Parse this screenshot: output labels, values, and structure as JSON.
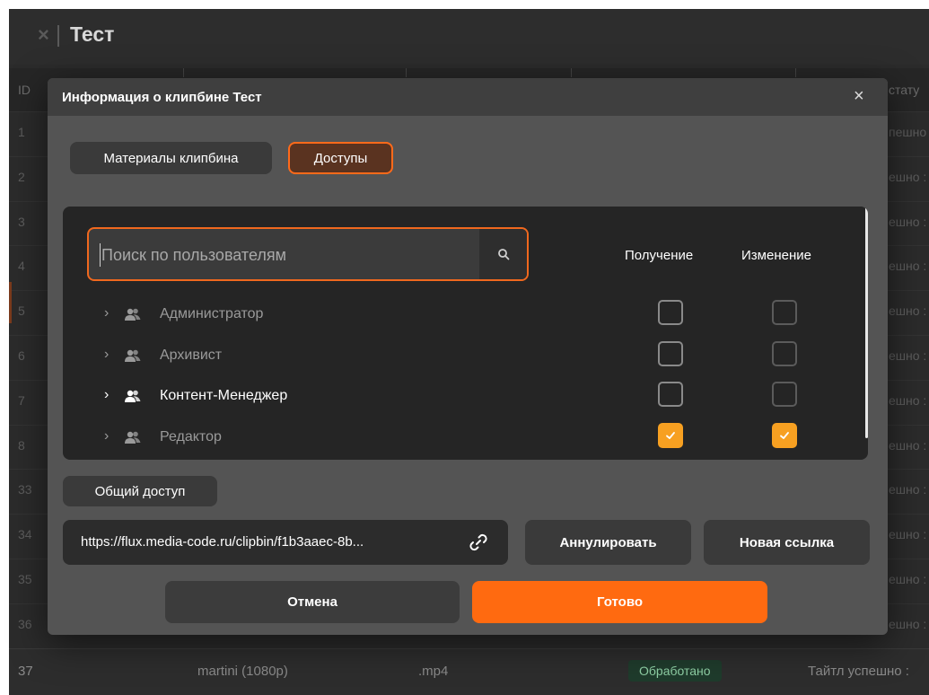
{
  "app": {
    "title": "Тест",
    "close_glyph": "×",
    "table": {
      "headers": {
        "id": "ID",
        "status": "стату"
      },
      "rows": [
        {
          "id": "1",
          "status": "пешно :"
        },
        {
          "id": "2",
          "status": "ешно :"
        },
        {
          "id": "3",
          "status": "ешно :"
        },
        {
          "id": "4",
          "status": "ешно :"
        },
        {
          "id": "5",
          "status": "ешно :"
        },
        {
          "id": "6",
          "status": "ешно :"
        },
        {
          "id": "7",
          "status": "ешно :"
        },
        {
          "id": "8",
          "status": "ешно :"
        },
        {
          "id": "33",
          "status": "ешно :"
        },
        {
          "id": "34",
          "status": "ешно :"
        },
        {
          "id": "35",
          "status": "ешно :"
        },
        {
          "id": "36",
          "status": "ешно :"
        }
      ],
      "last_row": {
        "id": "37",
        "name": "martini (1080p)",
        "ext": ".mp4",
        "badge": "Обработано",
        "status": "Тайтл успешно :"
      }
    }
  },
  "modal": {
    "title": "Информация о клипбине Тест",
    "close_glyph": "×",
    "tabs": [
      {
        "label": "Материалы клипбина",
        "active": false
      },
      {
        "label": "Доступы",
        "active": true
      }
    ],
    "search": {
      "placeholder": "Поиск по пользователям",
      "value": ""
    },
    "columns": {
      "receive": "Получение",
      "edit": "Изменение"
    },
    "groups": [
      {
        "name": "Администратор",
        "receive": false,
        "edit": false,
        "active": false
      },
      {
        "name": "Архивист",
        "receive": false,
        "edit": false,
        "active": false
      },
      {
        "name": "Контент-Менеджер",
        "receive": false,
        "edit": false,
        "active": true
      },
      {
        "name": "Редактор",
        "receive": true,
        "edit": true,
        "active": false
      }
    ],
    "share": {
      "label": "Общий доступ",
      "link": "https://flux.media-code.ru/clipbin/f1b3aaec-8b...",
      "revoke_label": "Аннулировать",
      "new_link_label": "Новая ссылка"
    },
    "footer": {
      "cancel_label": "Отмена",
      "done_label": "Готово"
    }
  },
  "colors": {
    "accent": "#ff6a10",
    "checkbox_checked": "#f7a021",
    "modal_bg": "#545454",
    "panel_bg": "#252525"
  },
  "icons": [
    "search-icon",
    "chevron-right-icon",
    "user-group-icon",
    "checkmark-icon",
    "link-icon",
    "close-icon"
  ]
}
